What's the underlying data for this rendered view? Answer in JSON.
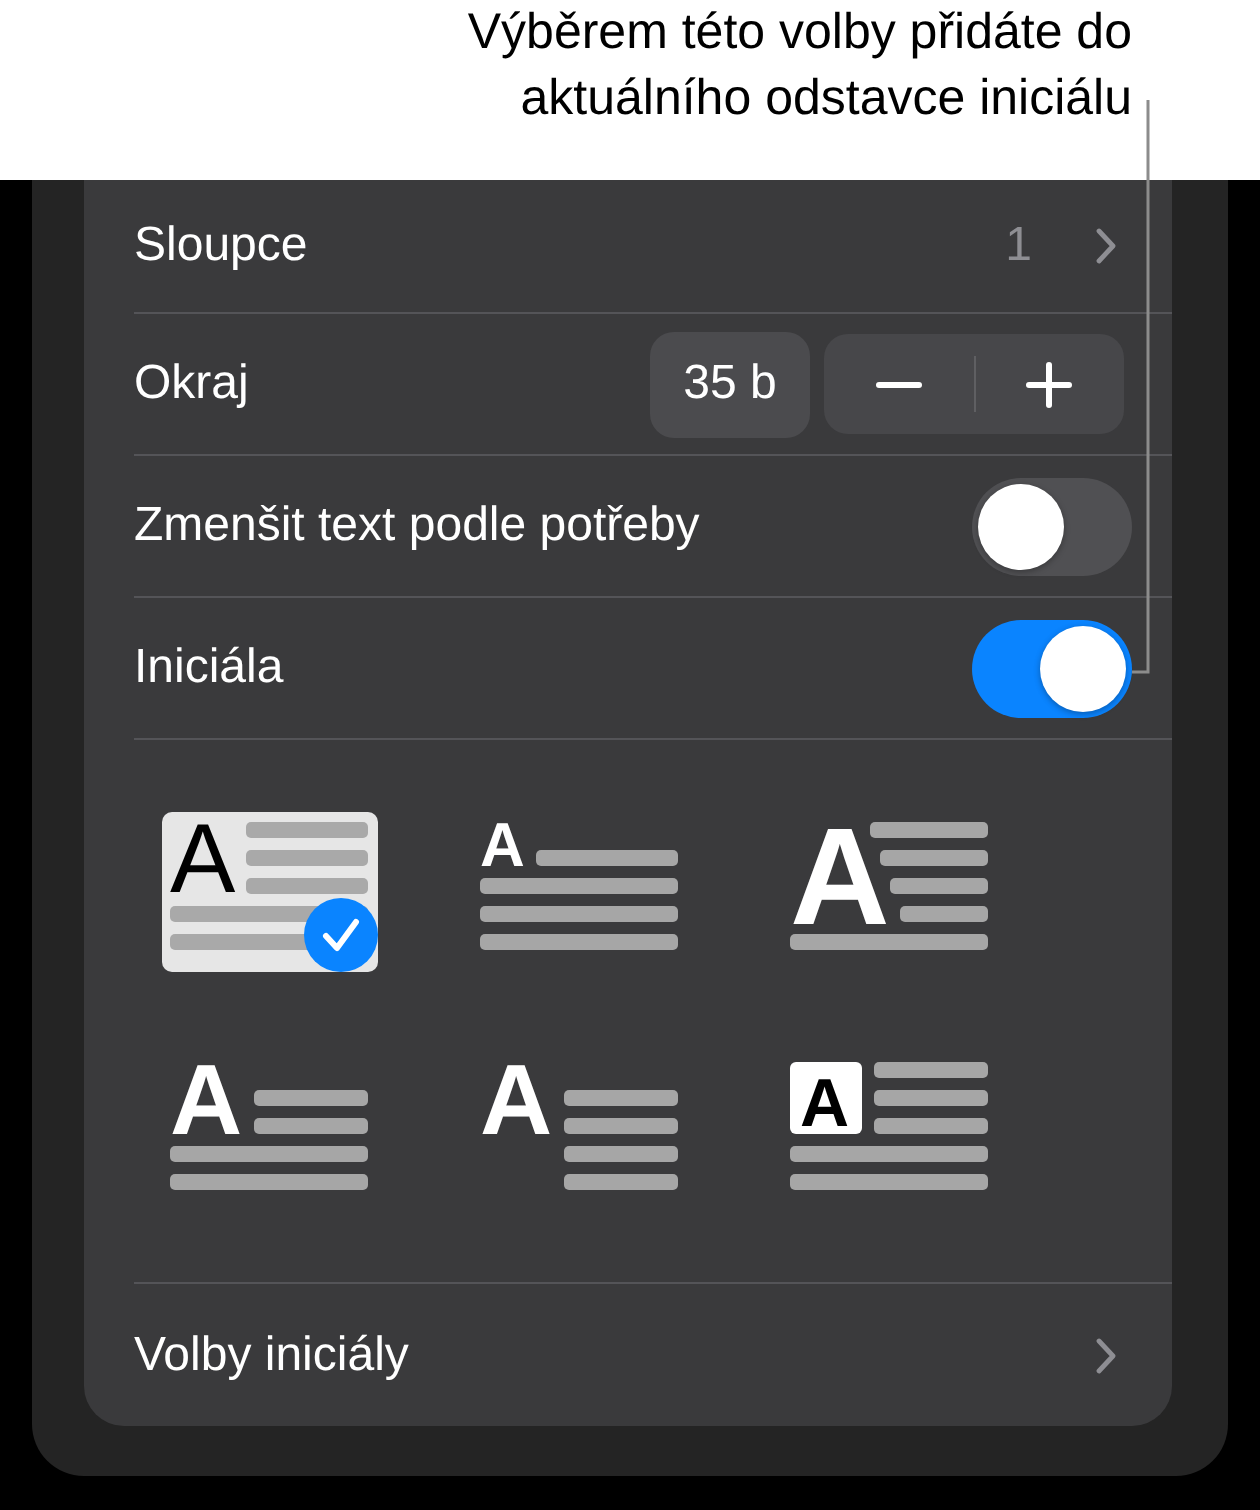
{
  "callout": {
    "text": "Výběrem této volby přidáte do aktuálního odstavce iniciálu"
  },
  "settings": [
    {
      "kind": "disclosure",
      "label": "Sloupce",
      "value": "1"
    },
    {
      "kind": "stepper",
      "label": "Okraj",
      "value": "35 b"
    },
    {
      "kind": "toggle",
      "label": "Zmenšit text podle potřeby",
      "on": false
    },
    {
      "kind": "toggle",
      "label": "Iniciála",
      "on": true
    }
  ],
  "drop_cap_styles": [
    {
      "kind": "inset-3",
      "letter": "A",
      "selected": true
    },
    {
      "kind": "raised",
      "letter": "A",
      "selected": false
    },
    {
      "kind": "inset-4",
      "letter": "A",
      "selected": false
    },
    {
      "kind": "inset-2",
      "letter": "A",
      "selected": false
    },
    {
      "kind": "hanging",
      "letter": "A",
      "selected": false
    },
    {
      "kind": "boxed",
      "letter": "A",
      "selected": false
    }
  ],
  "options_row": {
    "kind": "disclosure",
    "label": "Volby iniciály"
  }
}
